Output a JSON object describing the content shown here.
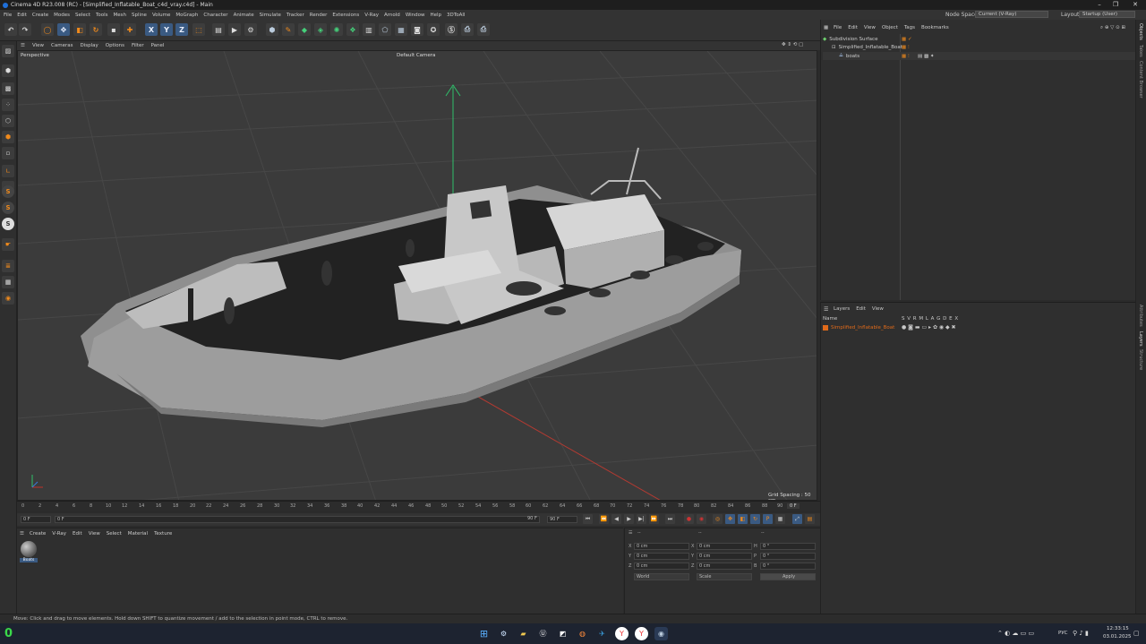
{
  "window": {
    "title": "Cinema 4D R23.008 (RC) - [Simplified_Inflatable_Boat_c4d_vray.c4d] - Main",
    "controls": [
      "–",
      "❐",
      "✕"
    ]
  },
  "menubar": {
    "items": [
      "File",
      "Edit",
      "Create",
      "Modes",
      "Select",
      "Tools",
      "Mesh",
      "Spline",
      "Volume",
      "MoGraph",
      "Character",
      "Animate",
      "Simulate",
      "Tracker",
      "Render",
      "Extensions",
      "V-Ray",
      "Arnold",
      "Window",
      "Help",
      "3DToAll"
    ],
    "node_space_label": "Node Space:",
    "node_space_value": "Current (V-Ray)",
    "layout_label": "Layout:",
    "layout_value": "Startup (User)"
  },
  "toolbar": {
    "axis_x": "X",
    "axis_y": "Y",
    "axis_z": "Z"
  },
  "viewport": {
    "menu": [
      "View",
      "Cameras",
      "Display",
      "Options",
      "Filter",
      "Panel"
    ],
    "view_name": "Perspective",
    "camera": "Default Camera",
    "grid_spacing": "Grid Spacing : 50 cm"
  },
  "timeline": {
    "ticks": [
      "0",
      "2",
      "4",
      "6",
      "8",
      "10",
      "12",
      "14",
      "16",
      "18",
      "20",
      "22",
      "24",
      "26",
      "28",
      "30",
      "32",
      "34",
      "36",
      "38",
      "40",
      "42",
      "44",
      "46",
      "48",
      "50",
      "52",
      "54",
      "56",
      "58",
      "60",
      "62",
      "64",
      "66",
      "68",
      "70",
      "72",
      "74",
      "76",
      "78",
      "80",
      "82",
      "84",
      "86",
      "88",
      "90"
    ],
    "current_frame": "0 F",
    "start_frame": "0 F",
    "start_field": "0 F",
    "end_field": "90 F",
    "end_frame": "90 F"
  },
  "material_panel": {
    "menu": [
      "Create",
      "V-Ray",
      "Edit",
      "View",
      "Select",
      "Material",
      "Texture"
    ],
    "material_name": "Boats"
  },
  "coord_panel": {
    "rows": [
      {
        "a": "X",
        "av": "0 cm",
        "b": "X",
        "bv": "0 cm",
        "c": "H",
        "cv": "0 °"
      },
      {
        "a": "Y",
        "av": "0 cm",
        "b": "Y",
        "bv": "0 cm",
        "c": "P",
        "cv": "0 °"
      },
      {
        "a": "Z",
        "av": "0 cm",
        "b": "Z",
        "bv": "0 cm",
        "c": "B",
        "cv": "0 °"
      }
    ],
    "mode_world": "World",
    "mode_scale": "Scale",
    "apply": "Apply",
    "header_left": "--",
    "header_mid": "--",
    "header_right": "--"
  },
  "objects_panel": {
    "menu": [
      "File",
      "Edit",
      "View",
      "Object",
      "Tags",
      "Bookmarks"
    ],
    "objects": [
      {
        "name": "Subdivision Surface",
        "indent": 0,
        "color": "#6ecf6e"
      },
      {
        "name": "Simplified_Inflatable_Boat",
        "indent": 1,
        "color": "#cfcfcf"
      },
      {
        "name": "boats",
        "indent": 2,
        "color": "#9ab4d8"
      }
    ]
  },
  "layers_panel": {
    "menu": [
      "Layers",
      "Edit",
      "View"
    ],
    "name_header": "Name",
    "columns": "S V R M L A G D E X",
    "layer_name": "Simplified_Inflatable_Boat",
    "layer_color": "#e06a1a"
  },
  "right_tabs": [
    "Objects",
    "Takes",
    "Content Browser",
    "Attributes",
    "Layers",
    "Structure"
  ],
  "status": {
    "text": "Move: Click and drag to move elements. Hold down SHIFT to quantize movement / add to the selection in point mode, CTRL to remove."
  },
  "taskbar": {
    "time": "12:33:15",
    "date": "03.01.2025",
    "lang": "РУС",
    "widget_num": "0"
  },
  "colors": {
    "accent_blue": "#3a5a82",
    "accent_orange": "#f08a1c",
    "axis_green": "#2fbf6a",
    "axis_red": "#c0302a"
  }
}
